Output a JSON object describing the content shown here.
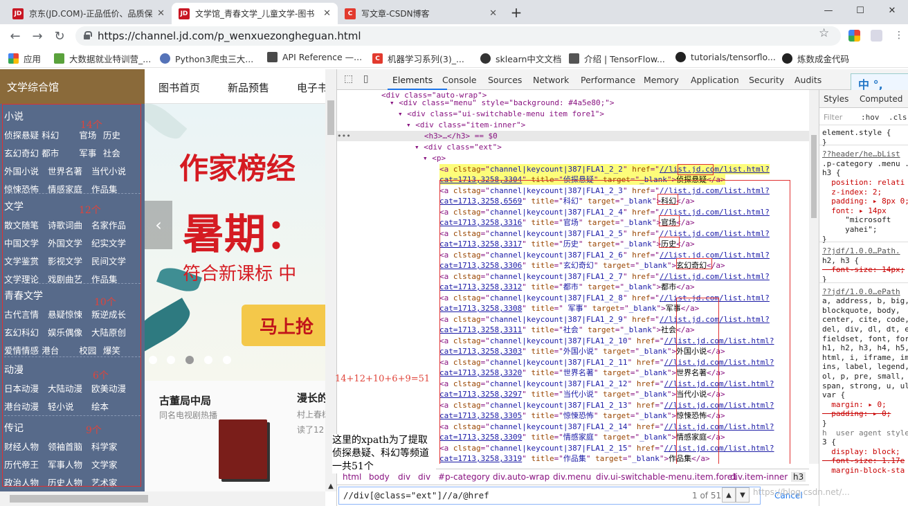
{
  "browser": {
    "tabs": [
      {
        "title": "京东(JD.COM)-正品低价、品质保",
        "icon": "JD"
      },
      {
        "title": "文学馆_青春文学_儿童文学-图书",
        "icon": "JD"
      },
      {
        "title": "写文章-CSDN博客",
        "icon": "C"
      }
    ],
    "url": "https://channel.jd.com/p_wenxuezongheguan.html",
    "bookmarks": [
      "应用",
      "大数据就业特训营_...",
      "Python3爬虫三大...",
      "API Reference —...",
      "机器学习系列(3)_...",
      "sklearn中文文档",
      "介绍 | TensorFlow...",
      "tutorials/tensorflo...",
      "炼数成金代码"
    ]
  },
  "page": {
    "sidebar_title": "文学综合馆",
    "nav": [
      "图书首页",
      "新品预售",
      "电子书"
    ],
    "categories": [
      {
        "title": "小说",
        "note": "14个",
        "items": [
          "侦探悬疑",
          "科幻",
          "官场",
          "历史",
          "玄幻奇幻",
          "都市",
          "军事",
          "社会",
          "外国小说",
          "世界名著",
          "当代小说",
          "惊悚恐怖",
          "情感家庭",
          "作品集"
        ]
      },
      {
        "title": "文学",
        "note": "12个",
        "items": [
          "散文随笔",
          "诗歌词曲",
          "名家作品",
          "中国文学",
          "外国文学",
          "纪实文学",
          "文学鉴赏",
          "影视文学",
          "民间文学",
          "文学理论",
          "戏剧曲艺",
          "作品集"
        ]
      },
      {
        "title": "青春文学",
        "note": "10个",
        "items": [
          "古代言情",
          "悬疑惊悚",
          "叛逆成长",
          "玄幻科幻",
          "娱乐偶像",
          "大陆原创",
          "爱情情感",
          "港台",
          "校园",
          "爆笑"
        ]
      },
      {
        "title": "动漫",
        "note": "6个",
        "items": [
          "日本动漫",
          "大陆动漫",
          "欧美动漫",
          "港台动漫",
          "轻小说",
          "绘本"
        ]
      },
      {
        "title": "传记",
        "note": "9个",
        "items": [
          "财经人物",
          "领袖首脑",
          "科学家",
          "历代帝王",
          "军事人物",
          "文学家",
          "政治人物",
          "历史人物",
          "艺术家"
        ]
      }
    ],
    "banner": {
      "line1": "作家榜经",
      "line2": "暑期：",
      "line3": "符合新课标 中",
      "cta": "马上抢"
    },
    "cards": [
      {
        "title": "古董局中局",
        "subtitle": "同名电视剧热播"
      },
      {
        "title": "漫长的",
        "subtitle": "村上春树",
        "subtitle2": "读了12"
      }
    ]
  },
  "annotation": {
    "formula": "14+12+10+6+9=51",
    "note": "这里的xpath为了提取侦探悬疑、科幻等频道一共51个"
  },
  "devtools": {
    "tabs": [
      "Elements",
      "Console",
      "Sources",
      "Network",
      "Performance",
      "Memory",
      "Application",
      "Security",
      "Audits"
    ],
    "ime": "中 °,",
    "dom_head": [
      "<div class=\"auto-wrap\">",
      "<div class=\"menu\" style=\"background: #4a5e80;\">",
      "<div class=\"ui-switchable-menu item fore1\">",
      "<div class=\"item-inner\">",
      "<h3>…</h3> == $0",
      "<div class=\"ext\">",
      "<p>"
    ],
    "links": [
      {
        "n": "2",
        "cat": "1713,3258,3304",
        "title": "侦探悬疑"
      },
      {
        "n": "3",
        "cat": "1713,3258,6569",
        "title": "科幻"
      },
      {
        "n": "4",
        "cat": "1713,3258,3316",
        "title": "官场"
      },
      {
        "n": "5",
        "cat": "1713,3258,3317",
        "title": "历史"
      },
      {
        "n": "6",
        "cat": "1713,3258,3306",
        "title": "玄幻奇幻"
      },
      {
        "n": "7",
        "cat": "1713,3258,3312",
        "title": "都市"
      },
      {
        "n": "8",
        "cat": "1713,3258,3308",
        "title": " 军事"
      },
      {
        "n": "9",
        "cat": "1713,3258,3311",
        "title": "社会"
      },
      {
        "n": "10",
        "cat": "1713,3258,3303",
        "title": "外国小说"
      },
      {
        "n": "11",
        "cat": "1713,3258,3320",
        "title": "世界名著"
      },
      {
        "n": "12",
        "cat": "1713,3258,3297",
        "title": "当代小说"
      },
      {
        "n": "13",
        "cat": "1713,3258,3305",
        "title": "惊悚恐怖"
      },
      {
        "n": "14",
        "cat": "1713,3258,3309",
        "title": "情感家庭"
      },
      {
        "n": "15",
        "cat": "1713,3258,3319",
        "title": "作品集"
      }
    ],
    "link_prefix": "channel|keycount|387|FLA1_2_",
    "link_href": "//list.jd.com/list.html?",
    "breadcrumbs": [
      "html",
      "body",
      "div",
      "div",
      "#p-category",
      "div.auto-wrap",
      "div.menu",
      "div.ui-switchable-menu.item.fore1",
      "div.item-inner",
      "h3"
    ],
    "search_value": "//div[@class=\"ext\"]//a/@href",
    "search_count": "1 of 51",
    "cancel": "Cancel",
    "styles_tabs": [
      "Styles",
      "Computed"
    ],
    "filter": "Filter",
    "hov": ":hov",
    "cls": ".cls",
    "style_lines": [
      {
        "t": "element.style {",
        "c": "v"
      },
      {
        "t": "}",
        "c": "v"
      },
      {
        "t": "??header/he…bList",
        "c": "link"
      },
      {
        "t": ".p-category .menu .",
        "c": "v"
      },
      {
        "t": "h3 {",
        "c": "v"
      },
      {
        "t": "  position: relati",
        "c": "p"
      },
      {
        "t": "  z-index: 2;",
        "c": "p"
      },
      {
        "t": "  padding: ▸ 8px 0;",
        "c": "p"
      },
      {
        "t": "  font: ▸ 14px",
        "c": "p"
      },
      {
        "t": "     \"microsoft",
        "c": "v"
      },
      {
        "t": "     yahei\";",
        "c": "v"
      },
      {
        "t": "}",
        "c": "v"
      },
      {
        "t": "??jdf/1.0.0…Path.",
        "c": "link"
      },
      {
        "t": "h2, h3 {",
        "c": "v"
      },
      {
        "t": "  font-size: 14px;",
        "c": "strike"
      },
      {
        "t": "}",
        "c": "v"
      },
      {
        "t": "??jdf/1.0.0…ePath",
        "c": "link"
      },
      {
        "t": "a, address, b, big,",
        "c": "v"
      },
      {
        "t": "blockquote, body,",
        "c": "v"
      },
      {
        "t": "center, cite, code,",
        "c": "v"
      },
      {
        "t": "del, div, dl, dt, e",
        "c": "v"
      },
      {
        "t": "fieldset, font, for",
        "c": "v"
      },
      {
        "t": "h1, h2, h3, h4, h5,",
        "c": "v"
      },
      {
        "t": "html, i, iframe, im",
        "c": "v"
      },
      {
        "t": "ins, label, legend,",
        "c": "v"
      },
      {
        "t": "ol, p, pre, small,",
        "c": "v"
      },
      {
        "t": "span, strong, u, ul",
        "c": "v"
      },
      {
        "t": "var {",
        "c": "v"
      },
      {
        "t": "  margin: ▸ 0;",
        "c": "p"
      },
      {
        "t": "  padding: ▸ 0;",
        "c": "strike"
      },
      {
        "t": "}",
        "c": "v"
      },
      {
        "t": "h  user agent style",
        "c": "gray"
      },
      {
        "t": "3 {",
        "c": "v"
      },
      {
        "t": "  display: block;",
        "c": "p"
      },
      {
        "t": "  font-size: 1.17e",
        "c": "strike"
      },
      {
        "t": "  margin-block-sta",
        "c": "p"
      }
    ]
  },
  "watermark": "https://blog.csdn.net/..."
}
